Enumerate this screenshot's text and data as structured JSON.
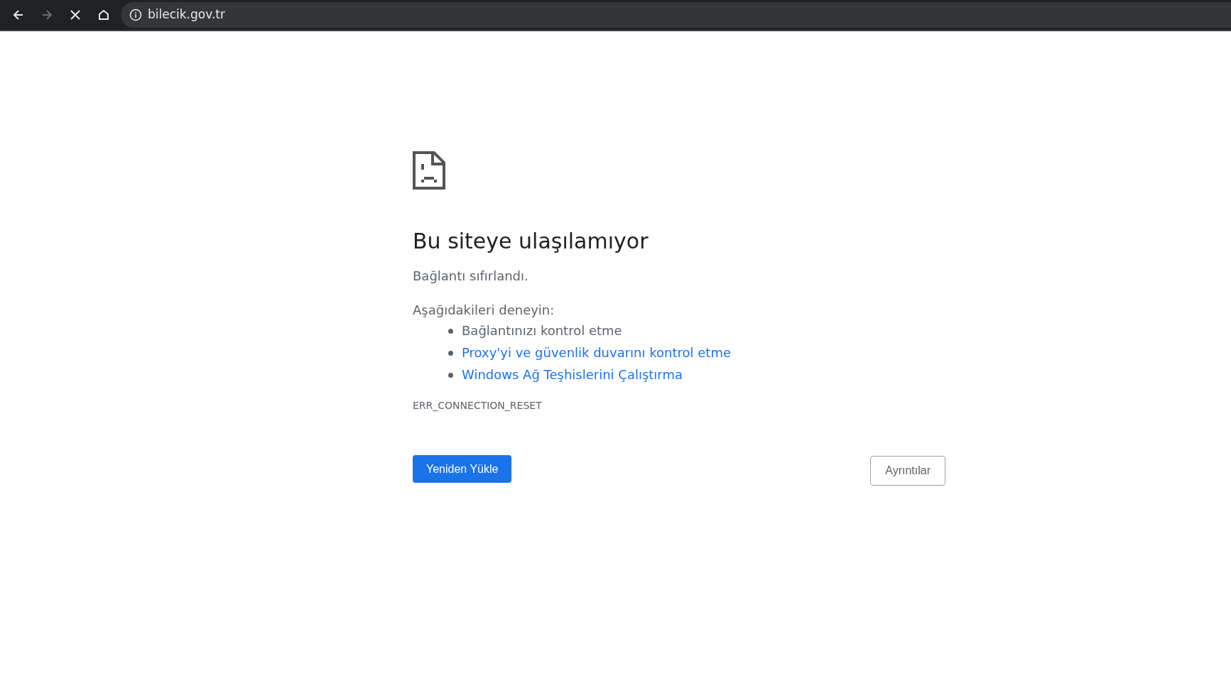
{
  "toolbar": {
    "buttons": [
      {
        "kind": "back",
        "disabled": false
      },
      {
        "kind": "forward",
        "disabled": true
      },
      {
        "kind": "stop",
        "disabled": false
      },
      {
        "kind": "home",
        "disabled": false
      }
    ],
    "address": "bilecik.gov.tr"
  },
  "error": {
    "title": "Bu siteye ulaşılamıyor",
    "message": "Bağlantı sıfırlandı.",
    "suggestions_heading": "Aşağıdakileri deneyin:",
    "suggestions": [
      {
        "kind": "text",
        "text": "Bağlantınızı kontrol etme"
      },
      {
        "kind": "link",
        "text": "Proxy'yi ve güvenlik duvarını kontrol etme"
      },
      {
        "kind": "link",
        "text": "Windows Ağ Teşhislerini Çalıştırma"
      }
    ],
    "code": "ERR_CONNECTION_RESET",
    "reload_button": "Yeniden Yükle",
    "details_button": "Ayrıntılar"
  }
}
